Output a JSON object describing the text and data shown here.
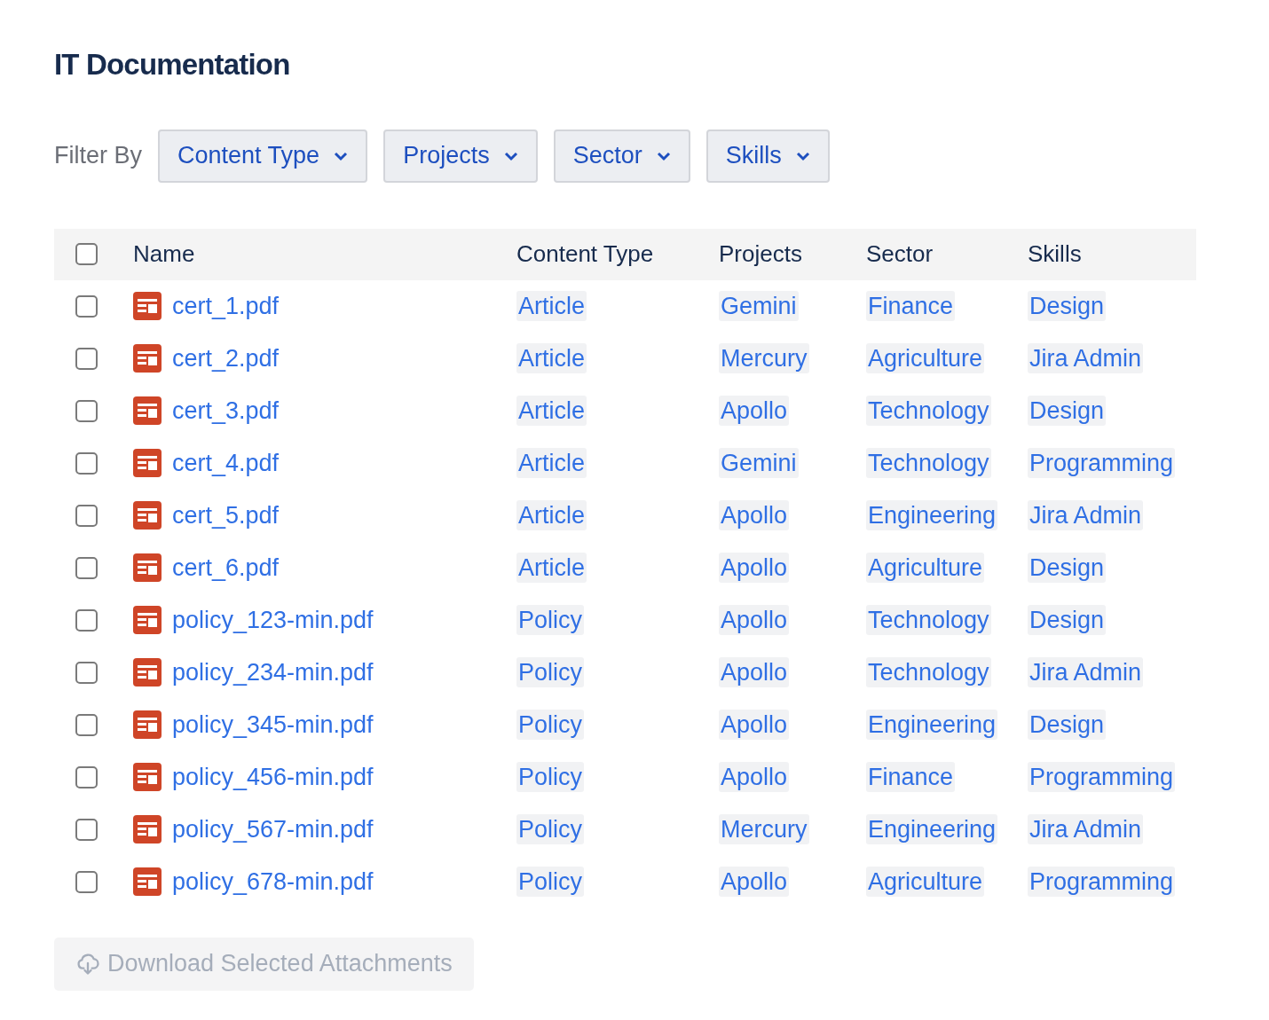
{
  "title": "IT Documentation",
  "filter": {
    "label": "Filter By",
    "dropdowns": [
      "Content Type",
      "Projects",
      "Sector",
      "Skills"
    ]
  },
  "table": {
    "select_all": {
      "checked": false
    },
    "columns": [
      "Name",
      "Content Type",
      "Projects",
      "Sector",
      "Skills"
    ],
    "rows": [
      {
        "checked": false,
        "name": "cert_1.pdf",
        "tags": [
          "Article",
          "Gemini",
          "Finance",
          "Design"
        ]
      },
      {
        "checked": false,
        "name": "cert_2.pdf",
        "tags": [
          "Article",
          "Mercury",
          "Agriculture",
          "Jira Admin"
        ]
      },
      {
        "checked": false,
        "name": "cert_3.pdf",
        "tags": [
          "Article",
          "Apollo",
          "Technology",
          "Design"
        ]
      },
      {
        "checked": false,
        "name": "cert_4.pdf",
        "tags": [
          "Article",
          "Gemini",
          "Technology",
          "Programming"
        ]
      },
      {
        "checked": false,
        "name": "cert_5.pdf",
        "tags": [
          "Article",
          "Apollo",
          "Engineering",
          "Jira Admin"
        ]
      },
      {
        "checked": false,
        "name": "cert_6.pdf",
        "tags": [
          "Article",
          "Apollo",
          "Agriculture",
          "Design"
        ]
      },
      {
        "checked": false,
        "name": "policy_123-min.pdf",
        "tags": [
          "Policy",
          "Apollo",
          "Technology",
          "Design"
        ]
      },
      {
        "checked": false,
        "name": "policy_234-min.pdf",
        "tags": [
          "Policy",
          "Apollo",
          "Technology",
          "Jira Admin"
        ]
      },
      {
        "checked": false,
        "name": "policy_345-min.pdf",
        "tags": [
          "Policy",
          "Apollo",
          "Engineering",
          "Design"
        ]
      },
      {
        "checked": false,
        "name": "policy_456-min.pdf",
        "tags": [
          "Policy",
          "Apollo",
          "Finance",
          "Programming"
        ]
      },
      {
        "checked": false,
        "name": "policy_567-min.pdf",
        "tags": [
          "Policy",
          "Mercury",
          "Engineering",
          "Jira Admin"
        ]
      },
      {
        "checked": false,
        "name": "policy_678-min.pdf",
        "tags": [
          "Policy",
          "Apollo",
          "Agriculture",
          "Programming"
        ]
      }
    ]
  },
  "download_button": {
    "label": "Download Selected Attachments",
    "disabled": true
  }
}
